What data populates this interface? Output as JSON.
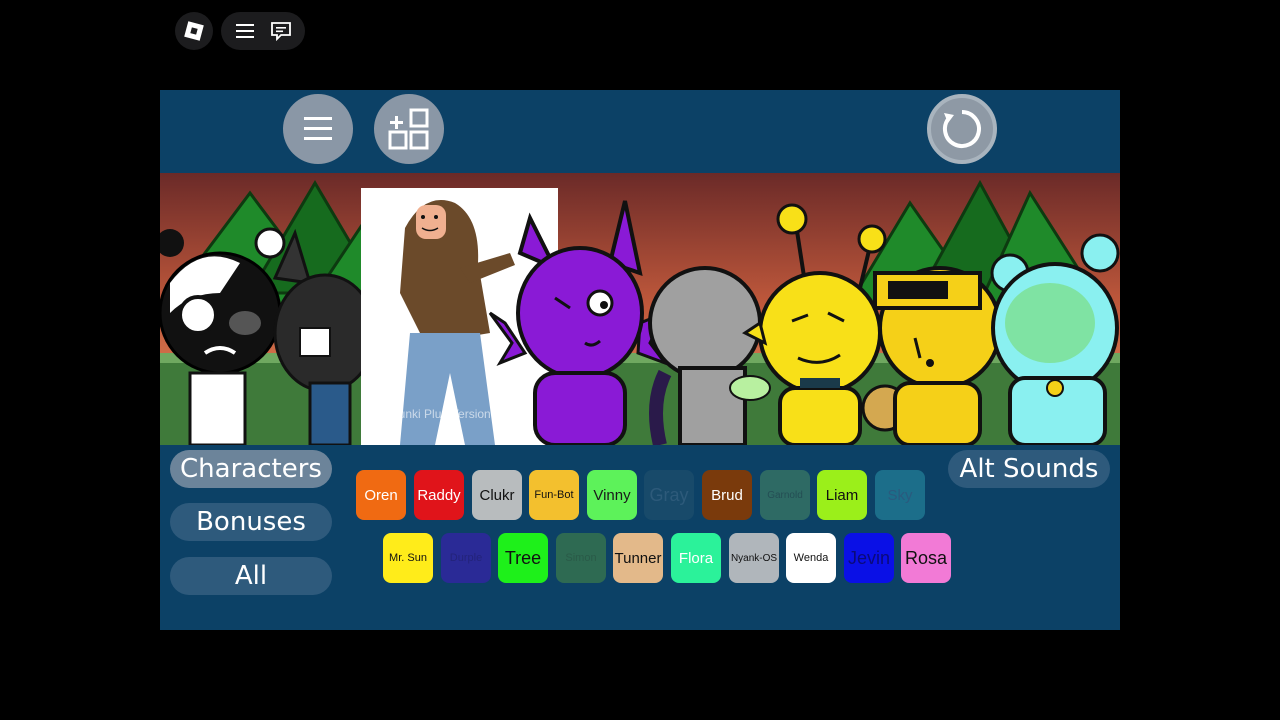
{
  "overlay": {
    "logo_icon": "roblox-logo-icon",
    "menu_icon": "hamburger-icon",
    "chat_icon": "chat-icon"
  },
  "toolbar": {
    "menu_icon": "hamburger-icon",
    "add_icon": "add-grid-icon",
    "reset_icon": "reset-icon"
  },
  "stage": {
    "watermark": "Sprunki Plus Version 45"
  },
  "categories": {
    "characters": "Characters",
    "bonuses": "Bonuses",
    "all": "All",
    "alt_sounds": "Alt Sounds"
  },
  "chips_row1": [
    {
      "label": "Oren",
      "color": "#f06a12",
      "text": "#ffffff"
    },
    {
      "label": "Raddy",
      "color": "#e0141a",
      "text": "#ffffff"
    },
    {
      "label": "Clukr",
      "color": "#b8bcbe",
      "text": "#111111"
    },
    {
      "label": "Fun-Bot",
      "color": "#f3c02e",
      "text": "#111111"
    },
    {
      "label": "Vinny",
      "color": "#5df25a",
      "text": "#1a1a1a"
    },
    {
      "label": "Gray",
      "color": "#184a6a",
      "text": "#2d5a7a"
    },
    {
      "label": "Brud",
      "color": "#7a3a0c",
      "text": "#ffffff"
    },
    {
      "label": "Garnold",
      "color": "#2e6a64",
      "text": "#244e54"
    },
    {
      "label": "Liam",
      "color": "#9bef1a",
      "text": "#111111"
    },
    {
      "label": "Sky",
      "color": "#1c6e8a",
      "text": "#2a5a7e"
    }
  ],
  "chips_row2": [
    {
      "label": "Mr. Sun",
      "color": "#ffec1a",
      "text": "#111111"
    },
    {
      "label": "Durple",
      "color": "#2a2a96",
      "text": "#23237a"
    },
    {
      "label": "Tree",
      "color": "#1ef01a",
      "text": "#111111"
    },
    {
      "label": "Simon",
      "color": "#2e6a52",
      "text": "#2a5a48"
    },
    {
      "label": "Tunner",
      "color": "#e3b98a",
      "text": "#111111"
    },
    {
      "label": "Flora",
      "color": "#2bf29a",
      "text": "#ffffff"
    },
    {
      "label": "Nyank-OS",
      "color": "#b0b6bb",
      "text": "#111111"
    },
    {
      "label": "Wenda",
      "color": "#ffffff",
      "text": "#111111"
    },
    {
      "label": "Jevin",
      "color": "#0a10e6",
      "text": "#0a0a7a"
    },
    {
      "label": "Rosa",
      "color": "#f27ad6",
      "text": "#111111"
    }
  ],
  "colors": {
    "frame_bg": "#0c4166",
    "button_gray": "#8a97a6"
  }
}
